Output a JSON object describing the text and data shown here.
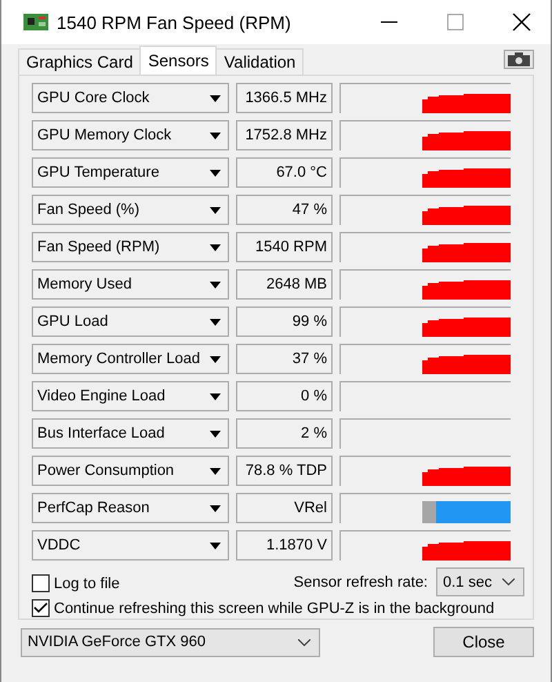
{
  "window": {
    "title": "1540 RPM Fan Speed (RPM)"
  },
  "tabs": [
    {
      "label": "Graphics Card",
      "selected": false
    },
    {
      "label": "Sensors",
      "selected": true
    },
    {
      "label": "Validation",
      "selected": false
    }
  ],
  "sensors": [
    {
      "name": "GPU Core Clock",
      "value": "1366.5 MHz",
      "kind": "graph"
    },
    {
      "name": "GPU Memory Clock",
      "value": "1752.8 MHz",
      "kind": "graph"
    },
    {
      "name": "GPU Temperature",
      "value": "67.0 °C",
      "kind": "graph"
    },
    {
      "name": "Fan Speed (%)",
      "value": "47 %",
      "kind": "graph"
    },
    {
      "name": "Fan Speed (RPM)",
      "value": "1540 RPM",
      "kind": "graph"
    },
    {
      "name": "Memory Used",
      "value": "2648 MB",
      "kind": "graph"
    },
    {
      "name": "GPU Load",
      "value": "99 %",
      "kind": "graph"
    },
    {
      "name": "Memory Controller Load",
      "value": "37 %",
      "kind": "graph"
    },
    {
      "name": "Video Engine Load",
      "value": "0 %",
      "kind": "blank"
    },
    {
      "name": "Bus Interface Load",
      "value": "2 %",
      "kind": "blank"
    },
    {
      "name": "Power Consumption",
      "value": "78.8 % TDP",
      "kind": "graph"
    },
    {
      "name": "PerfCap Reason",
      "value": "VRel",
      "kind": "perfcap"
    },
    {
      "name": "VDDC",
      "value": "1.1870 V",
      "kind": "graph"
    }
  ],
  "options": [
    {
      "label": "Log to file",
      "checked": false
    },
    {
      "label": "Continue refreshing this screen while GPU-Z is in the background",
      "checked": true
    }
  ],
  "refresh": {
    "label": "Sensor refresh rate:",
    "value": "0.1 sec"
  },
  "device": {
    "value": "NVIDIA GeForce GTX 960"
  },
  "buttons": [
    "Close"
  ]
}
